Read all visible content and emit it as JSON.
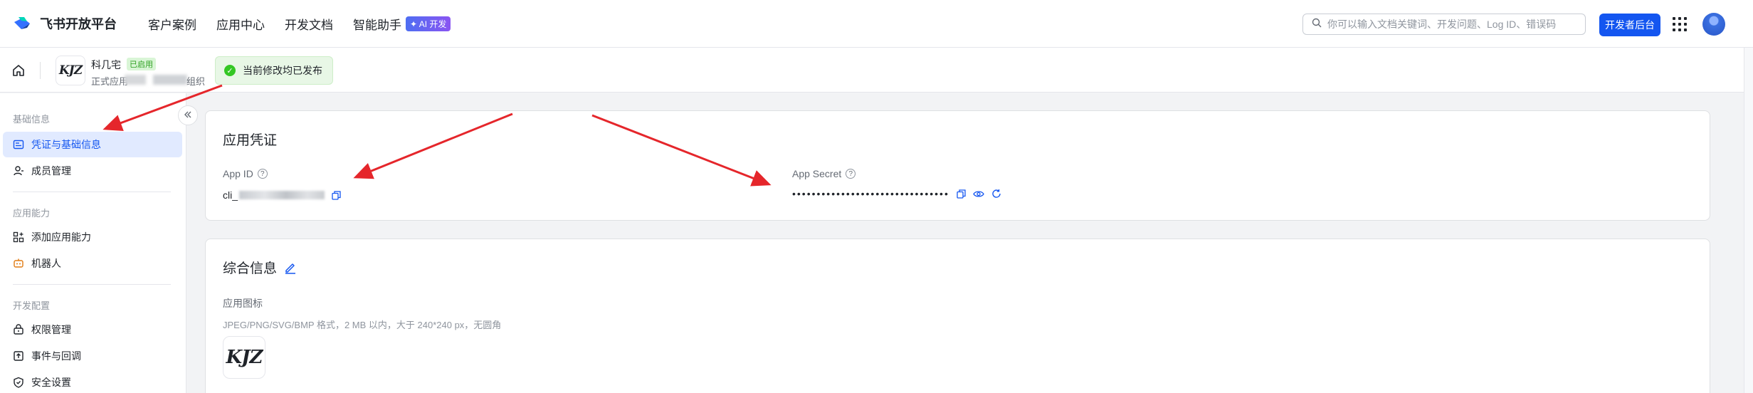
{
  "topbar": {
    "brand": "飞书开放平台",
    "nav": [
      "客户案例",
      "应用中心",
      "开发文档",
      "智能助手"
    ],
    "ai_badge": "✦ AI 开发",
    "search_placeholder": "你可以输入文档关键词、开发问题、Log ID、错误码",
    "console_button": "开发者后台"
  },
  "app_header": {
    "logo_text": "KJZ",
    "name": "科几宅",
    "status": "已启用",
    "subtitle_prefix": "正式应用",
    "subtitle_suffix": "组织",
    "publish_tip": "当前修改均已发布"
  },
  "sidebar": {
    "sections": [
      {
        "title": "基础信息",
        "items": [
          {
            "label": "凭证与基础信息",
            "icon": "credential-icon",
            "active": true
          },
          {
            "label": "成员管理",
            "icon": "member-icon"
          }
        ]
      },
      {
        "title": "应用能力",
        "items": [
          {
            "label": "添加应用能力",
            "icon": "add-capability-icon"
          },
          {
            "label": "机器人",
            "icon": "robot-icon"
          }
        ]
      },
      {
        "title": "开发配置",
        "items": [
          {
            "label": "权限管理",
            "icon": "permission-icon"
          },
          {
            "label": "事件与回调",
            "icon": "event-icon"
          },
          {
            "label": "安全设置",
            "icon": "security-icon"
          }
        ]
      }
    ]
  },
  "credentials_card": {
    "title": "应用凭证",
    "app_id_label": "App ID",
    "app_id_value": "cli_",
    "app_secret_label": "App Secret",
    "app_secret_value": "••••••••••••••••••••••••••••••••"
  },
  "general_card": {
    "title": "综合信息",
    "icon_label": "应用图标",
    "icon_desc": "JPEG/PNG/SVG/BMP 格式，2 MB 以内，大于 240*240 px，无圆角",
    "icon_text": "KJZ"
  },
  "colors": {
    "primary": "#1456f0",
    "arrow": "#e5262b",
    "success": "#34c724"
  }
}
